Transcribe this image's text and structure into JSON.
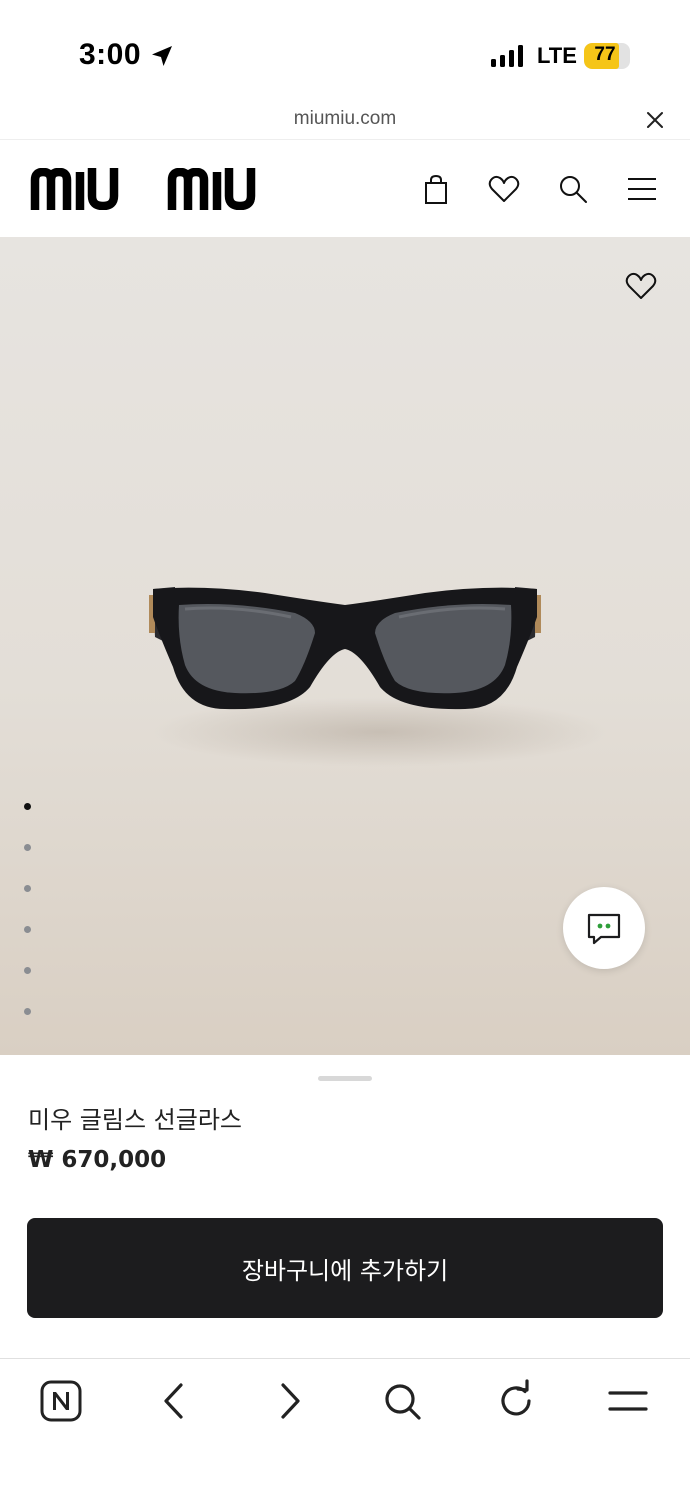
{
  "status_bar": {
    "time": "3:00",
    "network": "LTE",
    "battery_level": "77",
    "battery_fraction": 0.77,
    "location_icon": "location-arrow-icon",
    "signal_icon": "cellular-signal-icon"
  },
  "browser": {
    "url": "miumiu.com",
    "close_icon": "close-icon"
  },
  "header": {
    "logo_text": "miu miu",
    "icons": [
      "shopping-bag-icon",
      "heart-icon",
      "search-icon",
      "menu-icon"
    ]
  },
  "hero": {
    "image": "black cat-eye sunglasses",
    "wishlist_icon": "heart-icon",
    "carousel_total": 6,
    "carousel_active_index": 0,
    "chat_icon": "chat-bubble-icon"
  },
  "product": {
    "name": "미우 글림스 선글라스",
    "price": "₩ 670,000"
  },
  "cta": {
    "add_to_cart_label": "장바구니에 추가하기"
  },
  "toolbar": {
    "icons": [
      "naver-home-icon",
      "back-icon",
      "forward-icon",
      "search-icon",
      "reload-icon",
      "menu-icon"
    ]
  },
  "colors": {
    "cta_background": "#1c1c1e",
    "battery_accent": "#f5c518",
    "chat_dots": "#2e9e3a"
  }
}
